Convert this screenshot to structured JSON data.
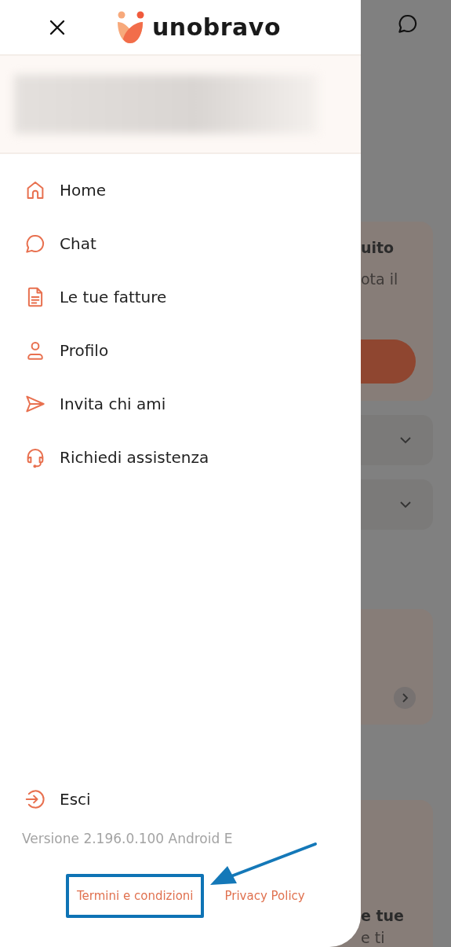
{
  "drawer": {
    "logo_text": "unobravo",
    "menu": [
      {
        "label": "Home"
      },
      {
        "label": "Chat"
      },
      {
        "label": "Le tue fatture"
      },
      {
        "label": "Profilo"
      },
      {
        "label": "Invita chi ami"
      },
      {
        "label": "Richiedi assistenza"
      }
    ],
    "logout": {
      "label": "Esci"
    },
    "version": "Versione 2.196.0.100 Android E",
    "links": [
      {
        "label": "Termini e condizioni",
        "highlighted": true
      },
      {
        "label": "Privacy Policy",
        "highlighted": false
      }
    ]
  },
  "background": {
    "card_title": "uito",
    "card_text": "ota il",
    "bottom_title": "e tue",
    "bottom_text": "e ti"
  }
}
